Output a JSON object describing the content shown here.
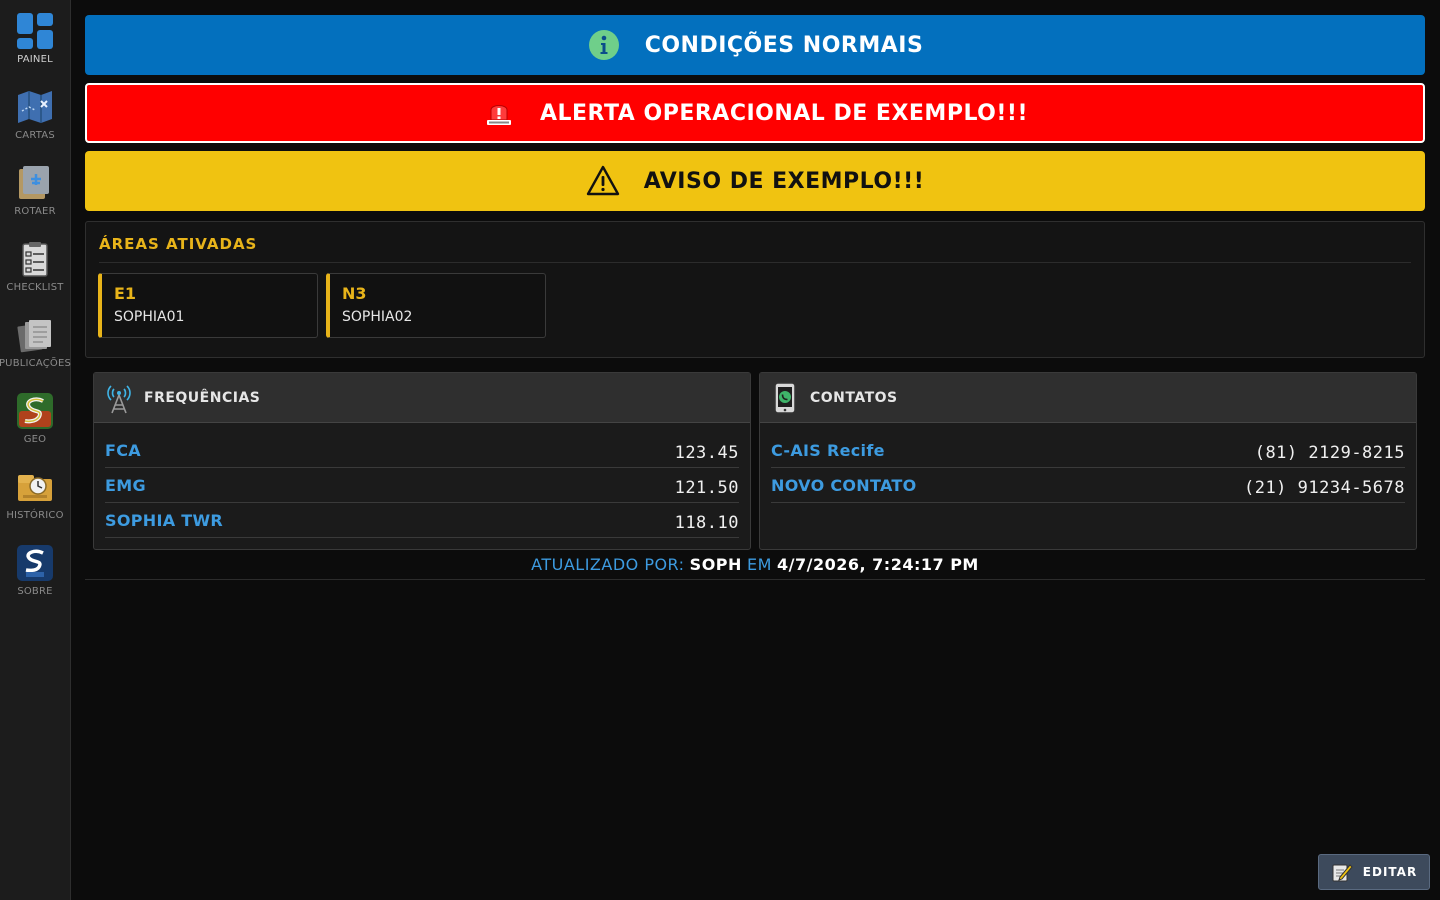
{
  "sidebar": {
    "items": [
      {
        "label": "PAINEL",
        "icon": "dashboard-icon",
        "active": true
      },
      {
        "label": "CARTAS",
        "icon": "chart-map-icon"
      },
      {
        "label": "ROTAER",
        "icon": "rotaer-icon"
      },
      {
        "label": "CHECKLIST",
        "icon": "checklist-icon"
      },
      {
        "label": "PUBLICAÇÕES",
        "icon": "publications-icon"
      },
      {
        "label": "GEO",
        "icon": "geo-icon"
      },
      {
        "label": "HISTÓRICO",
        "icon": "history-icon"
      },
      {
        "label": "SOBRE",
        "icon": "about-icon"
      }
    ]
  },
  "banners": {
    "info": {
      "text": "CONDIÇÕES NORMAIS",
      "icon": "info-icon",
      "color": "#0370be"
    },
    "alert": {
      "text": "ALERTA OPERACIONAL DE EXEMPLO!!!",
      "icon": "siren-icon",
      "color": "#ff0000"
    },
    "warning": {
      "text": "AVISO DE EXEMPLO!!!",
      "icon": "warning-icon",
      "color": "#f0c311"
    }
  },
  "areas": {
    "title": "ÁREAS ATIVADAS",
    "items": [
      {
        "code": "E1",
        "name": "SOPHIA01"
      },
      {
        "code": "N3",
        "name": "SOPHIA02"
      }
    ]
  },
  "frequencies": {
    "title": "FREQUÊNCIAS",
    "rows": [
      {
        "name": "FCA",
        "value": "123.45"
      },
      {
        "name": "EMG",
        "value": "121.50"
      },
      {
        "name": "SOPHIA TWR",
        "value": "118.10"
      }
    ]
  },
  "contacts": {
    "title": "CONTATOS",
    "rows": [
      {
        "name": "C-AIS Recife",
        "value": "(81) 2129-8215"
      },
      {
        "name": "NOVO CONTATO",
        "value": "(21) 91234-5678"
      }
    ]
  },
  "footer": {
    "updated_label": "ATUALIZADO POR:",
    "user": "SOPH",
    "em_label": "EM",
    "datetime": "4/7/2026, 7:24:17 PM"
  },
  "edit_button": {
    "label": "EDITAR",
    "icon": "edit-icon"
  },
  "colors": {
    "accent_yellow": "#e8b41a",
    "link_blue": "#3d9be0"
  }
}
